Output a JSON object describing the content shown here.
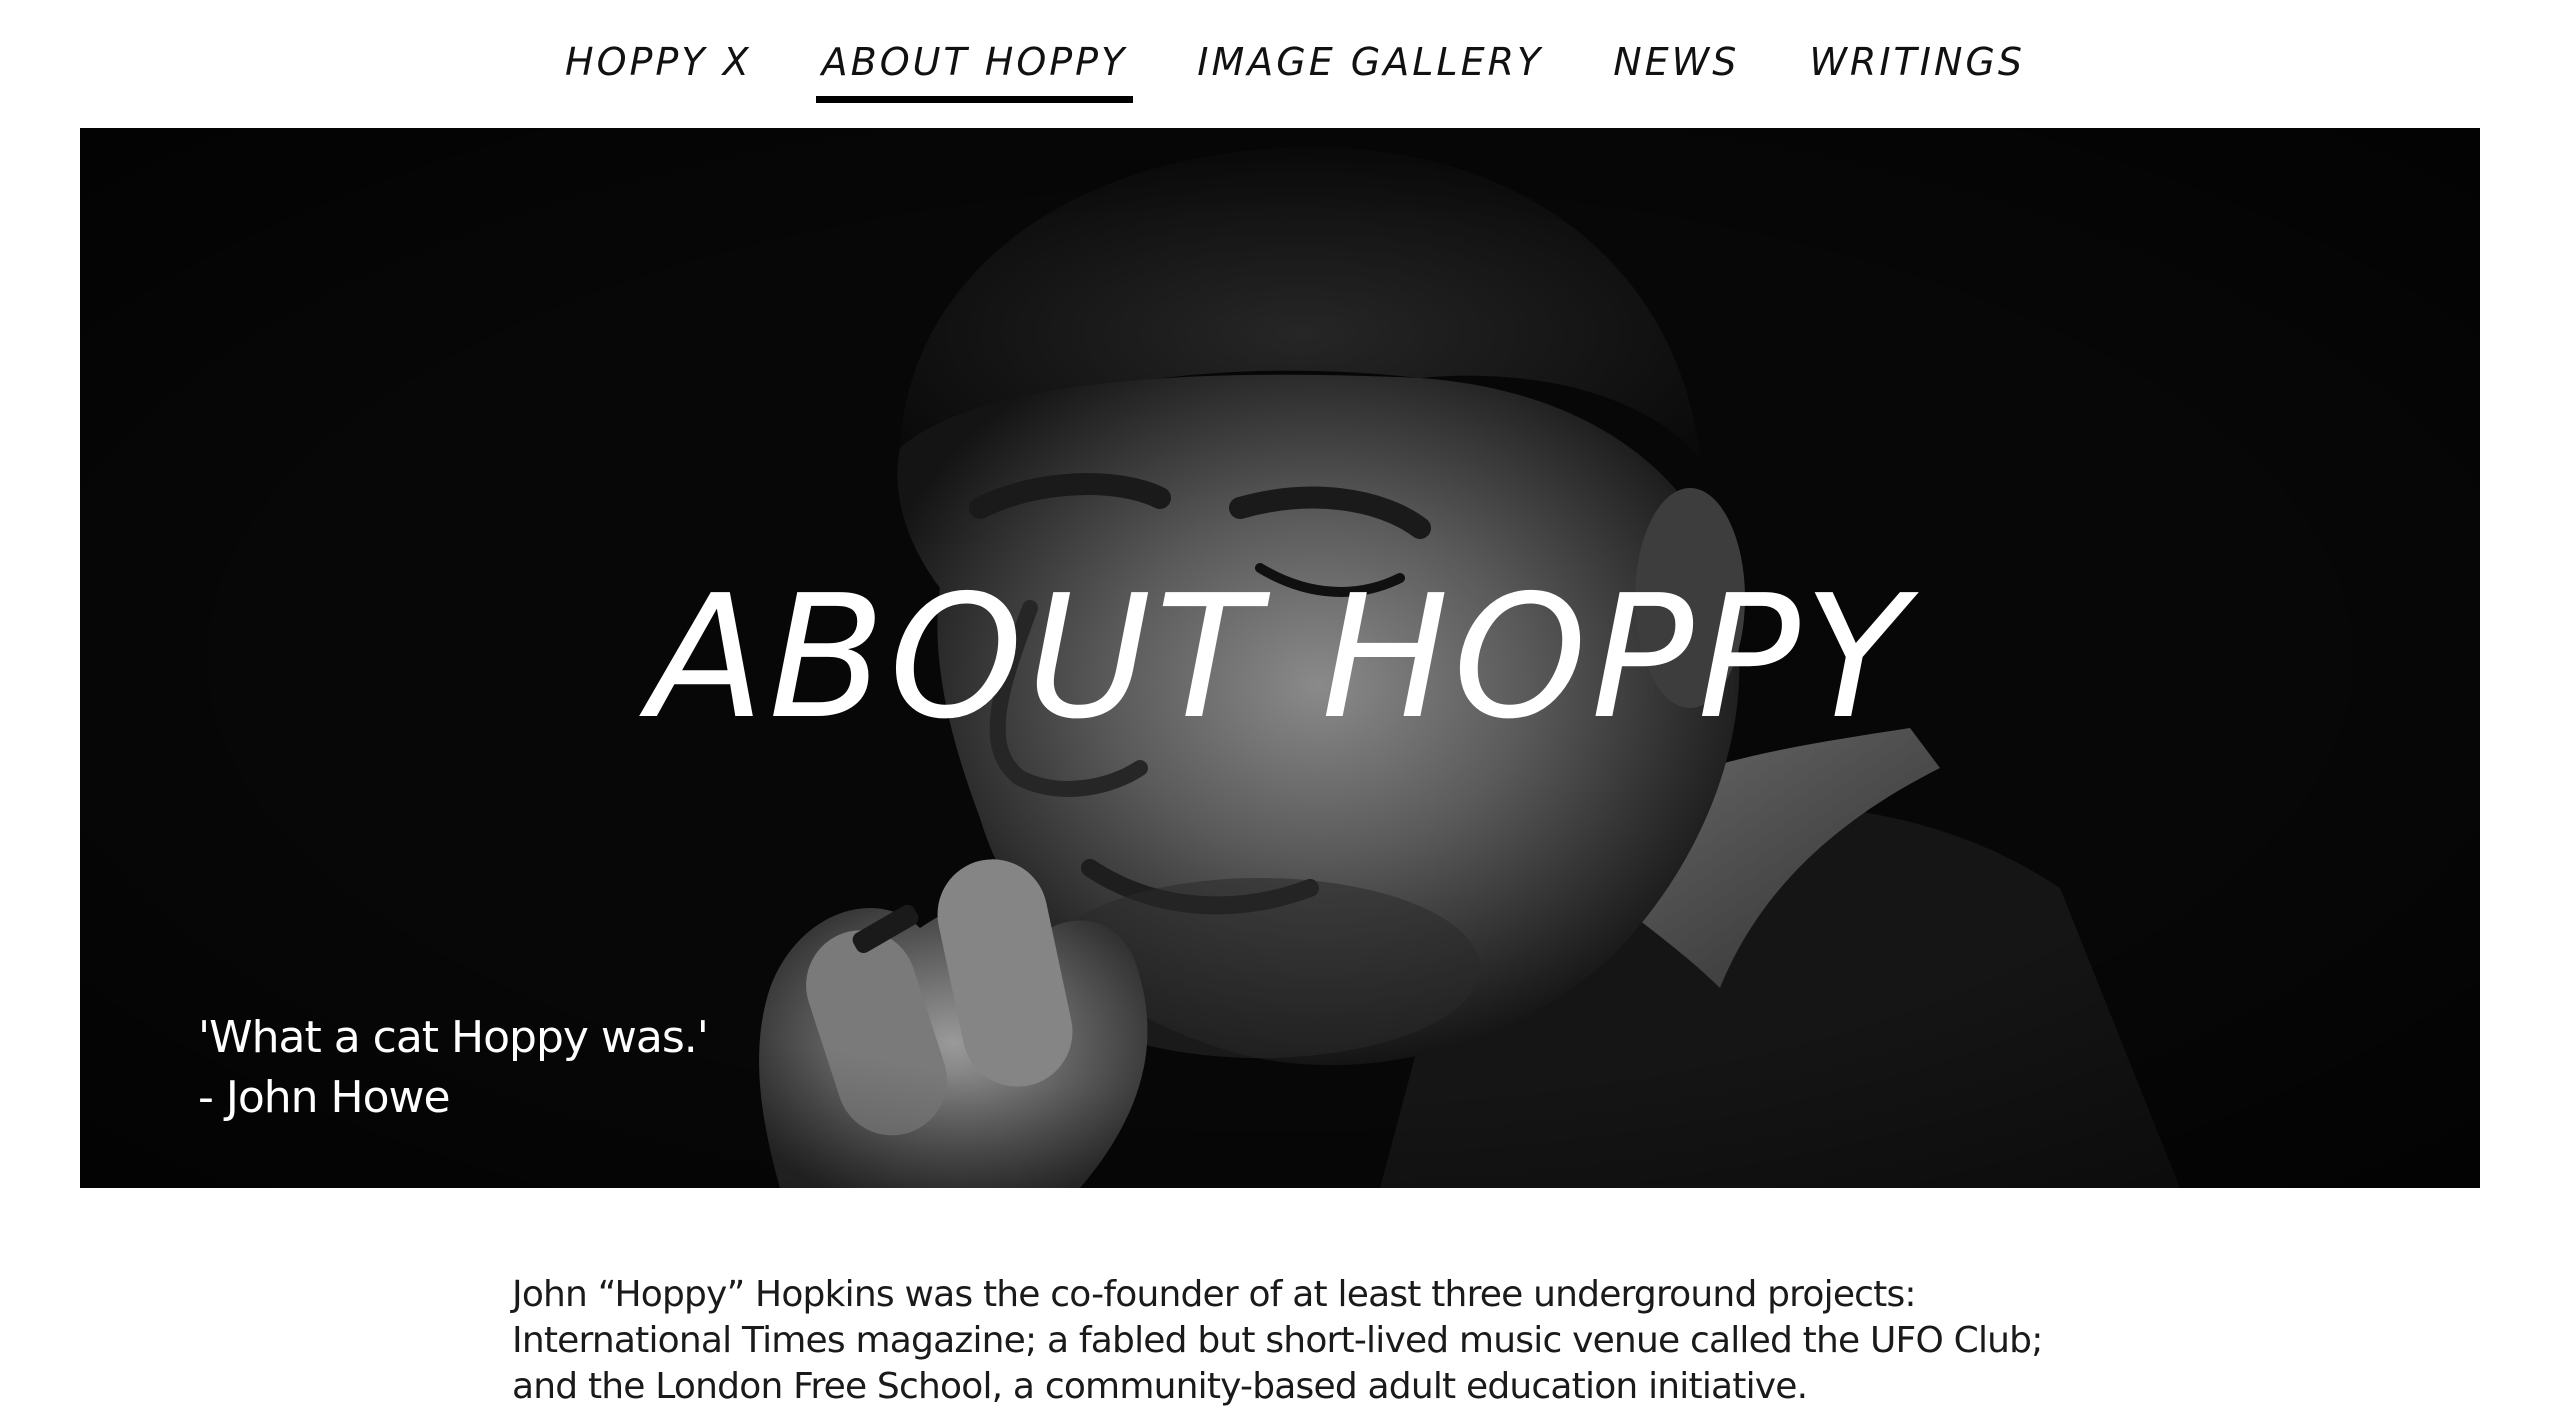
{
  "nav": {
    "items": [
      {
        "label": "HOPPY X",
        "active": false
      },
      {
        "label": "ABOUT HOPPY",
        "active": true
      },
      {
        "label": "IMAGE GALLERY",
        "active": false
      },
      {
        "label": "NEWS",
        "active": false
      },
      {
        "label": "WRITINGS",
        "active": false
      }
    ]
  },
  "hero": {
    "title": "ABOUT HOPPY",
    "quote_line1": "'What a cat Hoppy was.'",
    "quote_line2": "- John Howe",
    "image": "black-and-white-portrait-photo"
  },
  "intro": {
    "text": "John “Hoppy” Hopkins was the co-founder of at least three underground projects: International Times magazine; a fabled but short-lived music venue called the UFO Club; and the London Free School, a community-based adult education initiative."
  },
  "colors": {
    "background": "#ffffff",
    "text": "#111111",
    "hero_bg": "#070707",
    "hero_text": "#ffffff"
  }
}
